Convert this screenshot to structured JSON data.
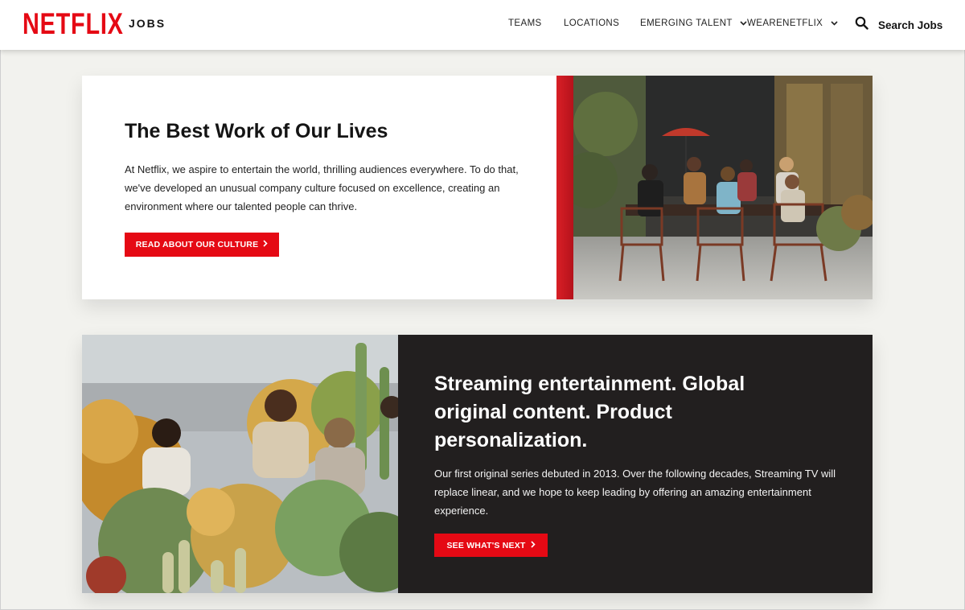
{
  "header": {
    "logo": "NETFLIX",
    "logo_sub": "JOBS",
    "nav": {
      "teams": "TEAMS",
      "locations": "LOCATIONS",
      "emerging_talent": "EMERGING TALENT",
      "wearenetflix": "WEARENETFLIX"
    },
    "search_label": "Search Jobs"
  },
  "culture": {
    "title": "The Best Work of Our Lives",
    "body": "At Netflix, we aspire to entertain the world, thrilling audiences everywhere. To do that, we've developed an unusual company culture focused on excellence, creating an environment where our talented people can thrive.",
    "button": "READ ABOUT OUR CULTURE"
  },
  "streaming": {
    "title": "Streaming entertainment. Global original content. Product personalization.",
    "body": "Our first original series debuted in 2013. Over the following decades, Streaming TV will replace linear, and we hope to keep leading by offering an amazing entertainment experience.",
    "button": "SEE WHAT'S NEXT"
  },
  "colors": {
    "brand_red": "#e50914",
    "dark_panel": "#221f1f",
    "page_bg": "#f2f2ee"
  },
  "icons": [
    "chevron-down-icon",
    "search-icon",
    "chevron-right-icon"
  ]
}
